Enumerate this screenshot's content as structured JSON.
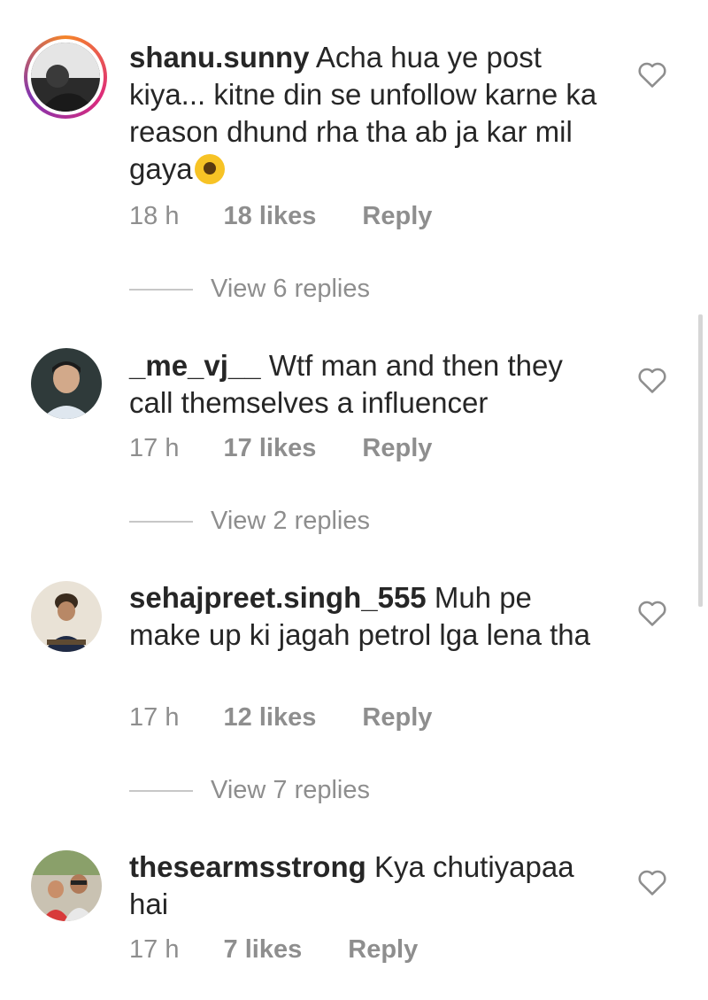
{
  "comments": [
    {
      "username": "shanu.sunny",
      "text": "Acha hua ye post kiya... kitne din se unfollow karne ka reason dhund rha tha ab ja kar mil gaya",
      "emoji_icon": "rolling-on-floor-laughing-emoji",
      "time": "18 h",
      "likes": "18 likes",
      "reply": "Reply",
      "view_replies": "View 6 replies",
      "has_story_ring": true
    },
    {
      "username": "_me_vj__",
      "text": "Wtf man and then they call themselves a influencer",
      "time": "17 h",
      "likes": "17 likes",
      "reply": "Reply",
      "view_replies": "View 2 replies"
    },
    {
      "username": "sehajpreet.singh_555",
      "text": "Muh pe make up ki jagah petrol lga lena tha",
      "time": "17 h",
      "likes": "12 likes",
      "reply": "Reply",
      "view_replies": "View 7 replies"
    },
    {
      "username": "thesearmsstrong",
      "text": "Kya chutiyapaa hai",
      "time": "17 h",
      "likes": "7 likes",
      "reply": "Reply"
    }
  ],
  "icons": {
    "like": "heart-outline-icon",
    "avatar": "avatar"
  },
  "colors": {
    "text": "#262626",
    "secondary": "#8e8e8e",
    "story_ring": "#dd2a7b"
  }
}
